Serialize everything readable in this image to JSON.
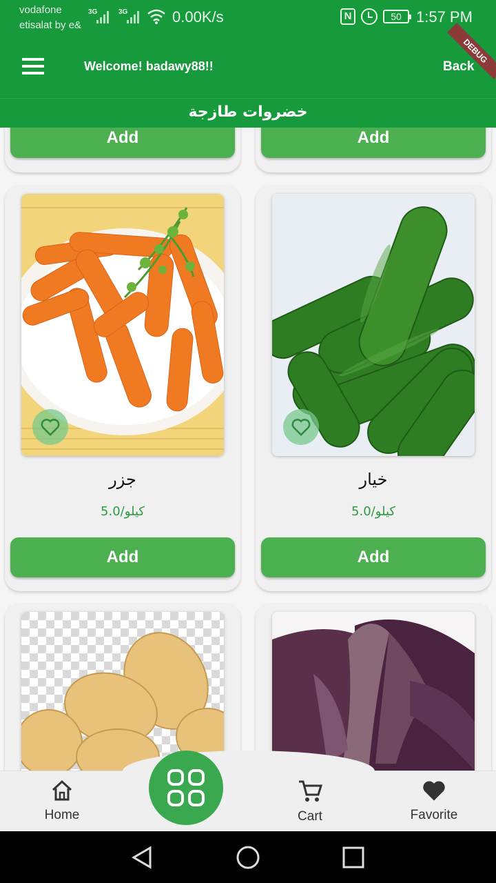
{
  "status_bar": {
    "carrier1": "vodafone",
    "carrier2": "etisalat by e&",
    "signal1": "3G",
    "signal2": "3G",
    "net_speed": "0.00K/s",
    "nfc": "N",
    "battery": "50",
    "time": "1:57 PM"
  },
  "app_bar": {
    "welcome": "Welcome! badawy88!!",
    "back_label": "Back",
    "debug_banner": "DEBUG"
  },
  "category_title": "خضروات طازجة",
  "products": [
    {
      "name": "جزر",
      "price": "5.0/كيلو",
      "add_label": "Add"
    },
    {
      "name": "خيار",
      "price": "5.0/كيلو",
      "add_label": "Add"
    }
  ],
  "partial_top": {
    "add_label_left": "Add",
    "add_label_right": "Add"
  },
  "bottom_nav": {
    "home": "Home",
    "cart": "Cart",
    "favorite": "Favorite"
  },
  "colors": {
    "primary": "#169a3b",
    "button": "#4caf50",
    "price": "#2e9a44"
  },
  "icons": [
    "menu-icon",
    "heart-outline-icon",
    "home-icon",
    "grid-icon",
    "cart-icon",
    "heart-filled-icon",
    "back-triangle-icon",
    "home-circle-icon",
    "recents-square-icon"
  ]
}
